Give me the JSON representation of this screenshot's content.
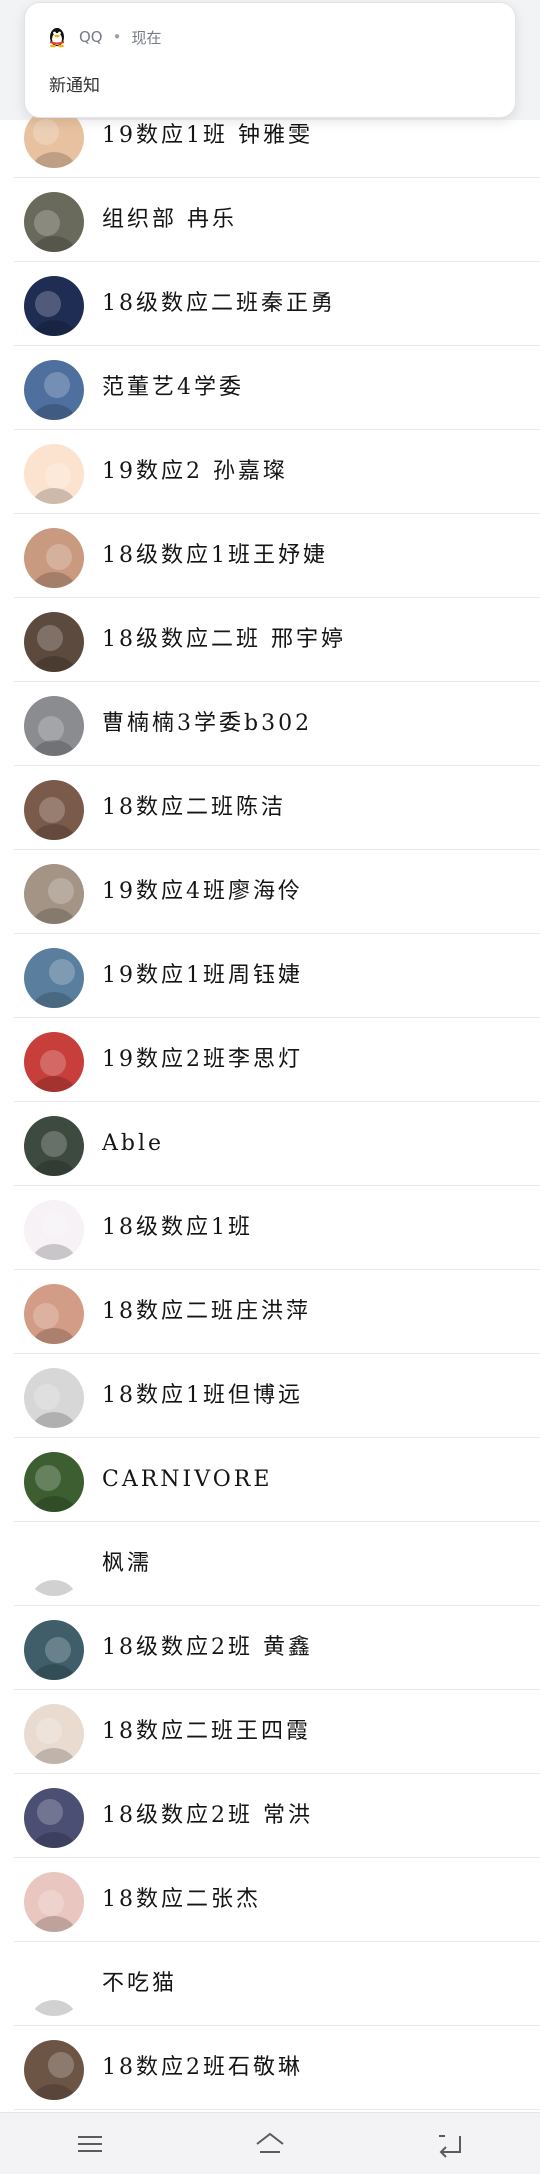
{
  "notification": {
    "app_name": "QQ",
    "separator": "•",
    "time": "现在",
    "message": "新通知"
  },
  "contacts": [
    {
      "name": "19数应1班 钟雅雯",
      "avatar": "child-face-photo",
      "bg": "#e8c2a0"
    },
    {
      "name": "组织部  冉乐",
      "avatar": "black-cat-photo",
      "bg": "#6a6a5c"
    },
    {
      "name": "18级数应二班秦正勇",
      "avatar": "night-sky-photo",
      "bg": "#1f2d55"
    },
    {
      "name": "范董艺4学委",
      "avatar": "anime-girl-avatar",
      "bg": "#4f6f9f"
    },
    {
      "name": "19数应2 孙嘉璨",
      "avatar": "cartoon-boy-avatar",
      "bg": "#fbe3d0"
    },
    {
      "name": "18级数应1班王妤婕",
      "avatar": "girl-portrait-photo",
      "bg": "#c99a80"
    },
    {
      "name": "18级数应二班 邢宇婷",
      "avatar": "sketch-girl-avatar",
      "bg": "#5c4a3e"
    },
    {
      "name": "曹楠楠3学委b302",
      "avatar": "husky-dog-photo",
      "bg": "#8a8c90"
    },
    {
      "name": "18数应二班陈洁",
      "avatar": "sunset-photo",
      "bg": "#7a5a4a"
    },
    {
      "name": "19数应4班廖海伶",
      "avatar": "cat-photo",
      "bg": "#a49486"
    },
    {
      "name": "19数应1班周钰婕",
      "avatar": "children-photo",
      "bg": "#5a7f9e"
    },
    {
      "name": "19数应2班李思灯",
      "avatar": "red-hood-child-photo",
      "bg": "#c83e3a"
    },
    {
      "name": "Able",
      "avatar": "couple-photo",
      "bg": "#3d4a40"
    },
    {
      "name": "18级数应1班",
      "avatar": "pink-heart-avatar",
      "bg": "#f6f2f6"
    },
    {
      "name": "18数应二班庄洪萍",
      "avatar": "girl-face-photo",
      "bg": "#d39c86"
    },
    {
      "name": "18数应1班但博远",
      "avatar": "notebook-photo",
      "bg": "#d7d7d7"
    },
    {
      "name": "CARNIVORE",
      "avatar": "flower-field-photo",
      "bg": "#3c5e30"
    },
    {
      "name": "枫濡",
      "avatar": "bear-cartoon-avatar",
      "bg": "#ffffff"
    },
    {
      "name": "18级数应2班 黄鑫",
      "avatar": "man-cap-photo",
      "bg": "#3f5e6a"
    },
    {
      "name": "18数应二班王四霞",
      "avatar": "cartoon-man-avatar",
      "bg": "#eadbd0"
    },
    {
      "name": "18级数应2班 常洪",
      "avatar": "city-night-photo",
      "bg": "#4a4f73"
    },
    {
      "name": "18数应二张杰",
      "avatar": "baby-photo",
      "bg": "#e9c6bf"
    },
    {
      "name": "不吃猫",
      "avatar": "cat-cartoon-avatar",
      "bg": "#ffffff"
    },
    {
      "name": "18数应2班石敬琳",
      "avatar": "girl-dark-hair-photo",
      "bg": "#6d5546"
    }
  ],
  "navbar": {
    "menu_icon": "menu-icon",
    "home_icon": "home-icon",
    "back_icon": "back-icon"
  }
}
